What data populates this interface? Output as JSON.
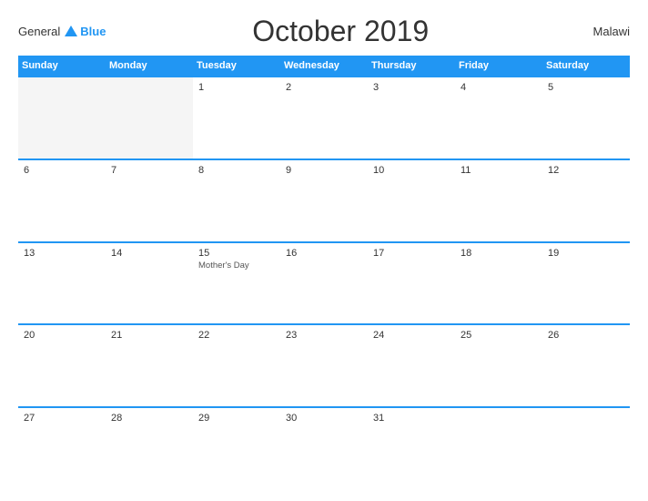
{
  "logo": {
    "general": "General",
    "blue": "Blue"
  },
  "title": "October 2019",
  "country": "Malawi",
  "header": {
    "days": [
      "Sunday",
      "Monday",
      "Tuesday",
      "Wednesday",
      "Thursday",
      "Friday",
      "Saturday"
    ]
  },
  "weeks": [
    [
      {
        "day": "",
        "empty": true
      },
      {
        "day": "",
        "empty": true
      },
      {
        "day": "1"
      },
      {
        "day": "2"
      },
      {
        "day": "3"
      },
      {
        "day": "4"
      },
      {
        "day": "5"
      }
    ],
    [
      {
        "day": "6"
      },
      {
        "day": "7"
      },
      {
        "day": "8"
      },
      {
        "day": "9"
      },
      {
        "day": "10"
      },
      {
        "day": "11"
      },
      {
        "day": "12"
      }
    ],
    [
      {
        "day": "13"
      },
      {
        "day": "14"
      },
      {
        "day": "15",
        "holiday": "Mother's Day"
      },
      {
        "day": "16"
      },
      {
        "day": "17"
      },
      {
        "day": "18"
      },
      {
        "day": "19"
      }
    ],
    [
      {
        "day": "20"
      },
      {
        "day": "21"
      },
      {
        "day": "22"
      },
      {
        "day": "23"
      },
      {
        "day": "24"
      },
      {
        "day": "25"
      },
      {
        "day": "26"
      }
    ],
    [
      {
        "day": "27"
      },
      {
        "day": "28"
      },
      {
        "day": "29"
      },
      {
        "day": "30"
      },
      {
        "day": "31"
      },
      {
        "day": "",
        "empty": false
      },
      {
        "day": "",
        "empty": false
      }
    ]
  ]
}
